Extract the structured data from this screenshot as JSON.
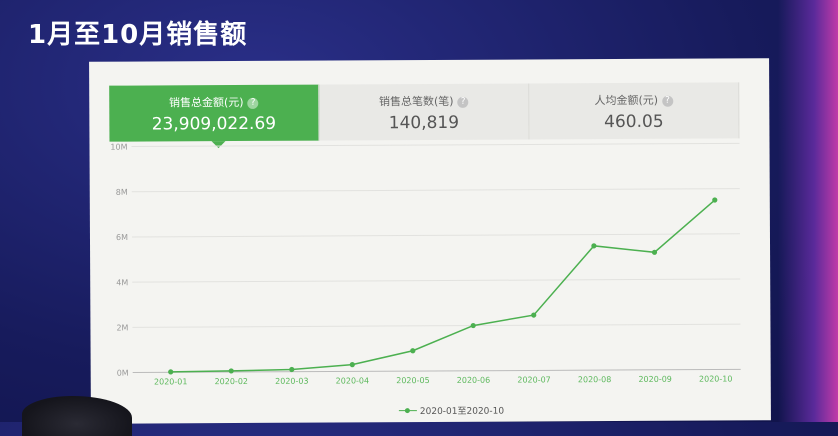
{
  "slide": {
    "title": "1月至10月销售额"
  },
  "stats": [
    {
      "label": "销售总金额(元)",
      "value": "23,909,022.69",
      "active": true
    },
    {
      "label": "销售总笔数(笔)",
      "value": "140,819",
      "active": false
    },
    {
      "label": "人均金额(元)",
      "value": "460.05",
      "active": false
    }
  ],
  "help_icon": "?",
  "colors": {
    "accent": "#4cb050",
    "line": "#4cb050"
  },
  "chart_data": {
    "type": "line",
    "x": [
      "2020-01",
      "2020-02",
      "2020-03",
      "2020-04",
      "2020-05",
      "2020-06",
      "2020-07",
      "2020-08",
      "2020-09",
      "2020-10"
    ],
    "series": [
      {
        "name": "2020-01至2020-10",
        "values": [
          20000,
          50000,
          100000,
          300000,
          900000,
          2000000,
          2450000,
          5500000,
          5200000,
          7500000
        ]
      }
    ],
    "yticks": [
      "0M",
      "2M",
      "4M",
      "6M",
      "8M",
      "10M"
    ],
    "ylim": [
      0,
      10000000
    ],
    "grid": true,
    "legend_position": "bottom"
  }
}
